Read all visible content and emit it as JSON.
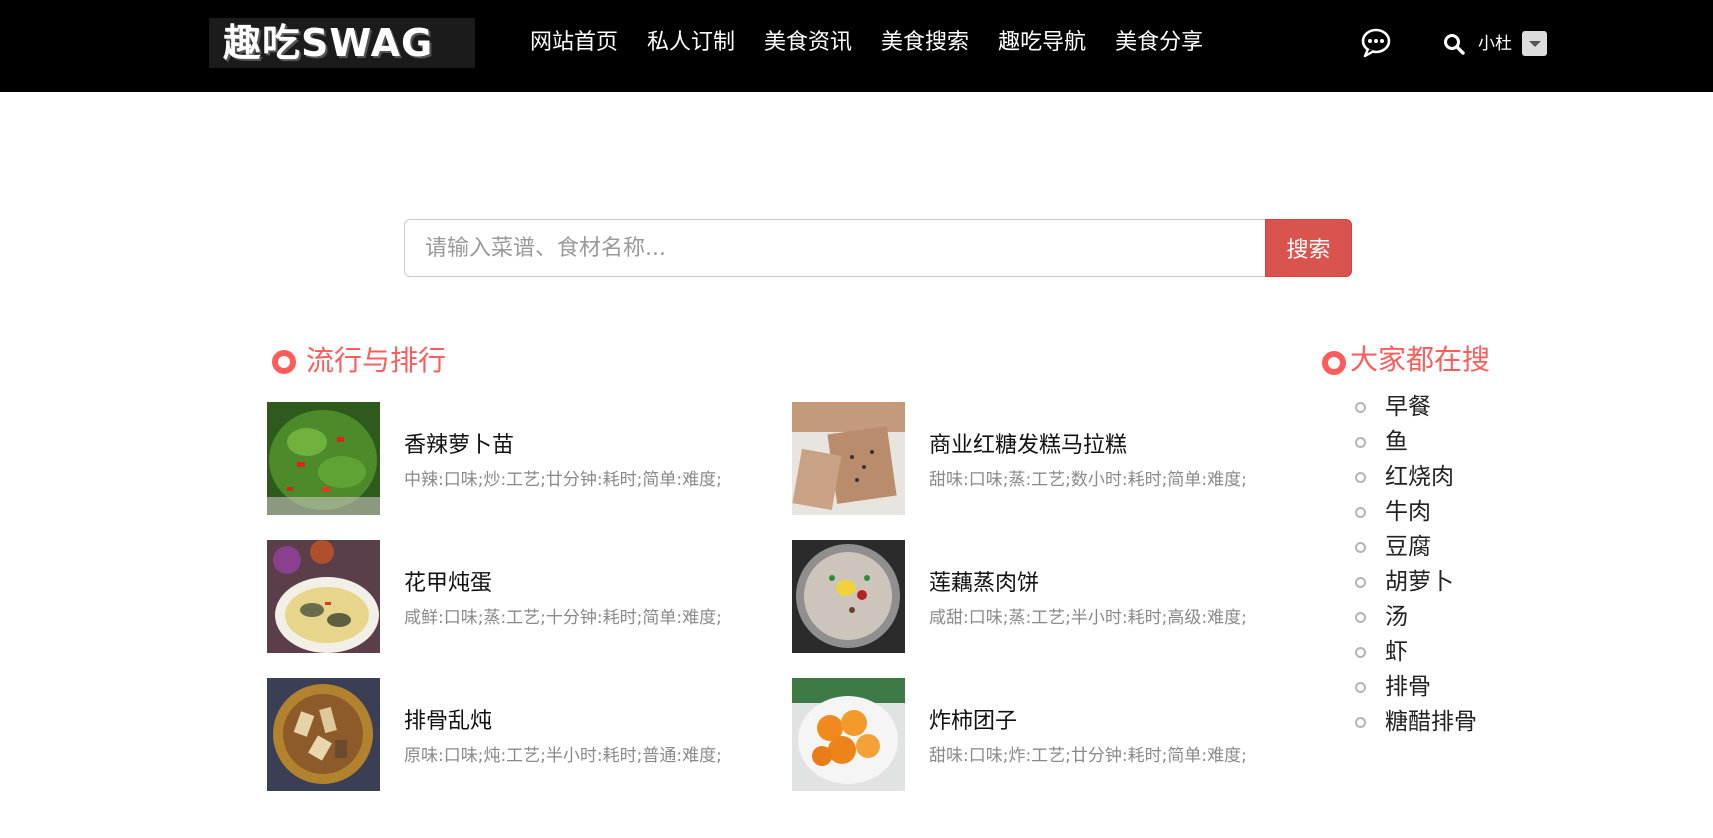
{
  "header": {
    "logo_text": "趣吃SWAG",
    "nav": [
      "网站首页",
      "私人订制",
      "美食资讯",
      "美食搜索",
      "趣吃导航",
      "美食分享"
    ],
    "username": "小杜",
    "icons": [
      "chat-bubble-icon",
      "search-icon",
      "dropdown-caret-icon"
    ]
  },
  "search": {
    "placeholder": "请输入菜谱、食材名称...",
    "button_label": "搜索"
  },
  "ranking": {
    "title": "流行与排行",
    "items": [
      {
        "name": "香辣萝卜苗",
        "meta": "中辣:口味;炒:工艺;廿分钟:耗时;简单:难度;"
      },
      {
        "name": "商业红糖发糕马拉糕",
        "meta": "甜味:口味;蒸:工艺;数小时:耗时;简单:难度;"
      },
      {
        "name": "花甲炖蛋",
        "meta": "咸鲜:口味;蒸:工艺;十分钟:耗时;简单:难度;"
      },
      {
        "name": "莲藕蒸肉饼",
        "meta": "咸甜:口味;蒸:工艺;半小时:耗时;高级:难度;"
      },
      {
        "name": "排骨乱炖",
        "meta": "原味:口味;炖:工艺;半小时:耗时;普通:难度;"
      },
      {
        "name": "炸柿团子",
        "meta": "甜味:口味;炸:工艺;廿分钟:耗时;简单:难度;"
      }
    ]
  },
  "popular": {
    "title": "大家都在搜",
    "items": [
      "早餐",
      "鱼",
      "红烧肉",
      "牛肉",
      "豆腐",
      "胡萝卜",
      "汤",
      "虾",
      "排骨",
      "糖醋排骨"
    ]
  },
  "colors": {
    "navbar_bg": "#000000",
    "accent": "#ff5c5c",
    "search_button": "#d9534f"
  }
}
